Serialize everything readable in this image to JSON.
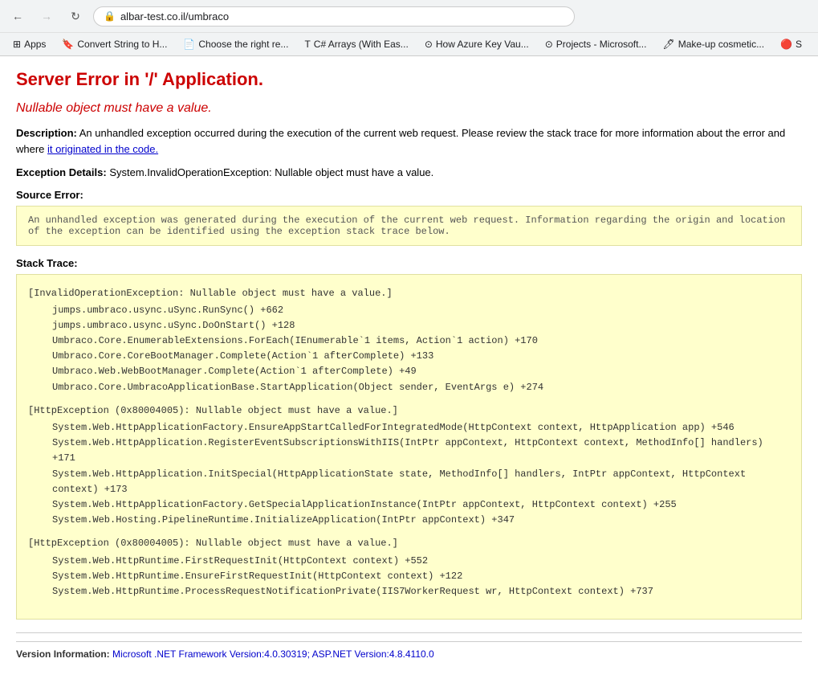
{
  "browser": {
    "url": "albar-test.co.il/umbraco",
    "back_disabled": false,
    "forward_disabled": true,
    "bookmarks": [
      {
        "id": "apps",
        "label": "Apps",
        "icon": "⊞"
      },
      {
        "id": "convert-string",
        "label": "Convert String to H...",
        "icon": "🔖"
      },
      {
        "id": "choose-right",
        "label": "Choose the right re...",
        "icon": "📄"
      },
      {
        "id": "csharp-arrays",
        "label": "C# Arrays (With Eas...",
        "icon": "T"
      },
      {
        "id": "azure-key",
        "label": "How Azure Key Vau...",
        "icon": "⊙"
      },
      {
        "id": "projects-ms",
        "label": "Projects - Microsoft...",
        "icon": "⊙"
      },
      {
        "id": "makeup",
        "label": "Make-up cosmetic...",
        "icon": "🖊"
      },
      {
        "id": "more",
        "label": "S",
        "icon": "🔴"
      }
    ]
  },
  "page": {
    "title": "Server Error in '/' Application.",
    "subtitle": "Nullable object must have a value.",
    "description_label": "Description:",
    "description_text": "An unhandled exception occurred during the execution of the current web request. Please review the stack trace for more information about the error and where",
    "description_link": "it originated in the code.",
    "exception_label": "Exception Details:",
    "exception_text": "System.InvalidOperationException: Nullable object must have a value.",
    "source_error_label": "Source Error:",
    "source_error_text": "An unhandled exception was generated during the execution of the current web request. Information regarding the origin and location of the exception can be identified using the exception stack trace below.",
    "stack_trace_label": "Stack Trace:",
    "stack_trace": [
      {
        "header": "[InvalidOperationException: Nullable object must have a value.]",
        "lines": [
          "jumps.umbraco.usync.uSync.RunSync() +662",
          "jumps.umbraco.usync.uSync.DoOnStart() +128",
          "Umbraco.Core.EnumerableExtensions.ForEach(IEnumerable`1 items, Action`1 action) +170",
          "Umbraco.Core.CoreBootManager.Complete(Action`1 afterComplete) +133",
          "Umbraco.Web.WebBootManager.Complete(Action`1 afterComplete) +49",
          "Umbraco.Core.UmbracoApplicationBase.StartApplication(Object sender, EventArgs e) +274"
        ]
      },
      {
        "header": "[HttpException (0x80004005): Nullable object must have a value.]",
        "lines": [
          "System.Web.HttpApplicationFactory.EnsureAppStartCalledForIntegratedMode(HttpContext context, HttpApplication app) +546",
          "System.Web.HttpApplication.RegisterEventSubscriptionsWithIIS(IntPtr appContext, HttpContext context, MethodInfo[] handlers) +171",
          "System.Web.HttpApplication.InitSpecial(HttpApplicationState state, MethodInfo[] handlers, IntPtr appContext, HttpContext context) +173",
          "System.Web.HttpApplicationFactory.GetSpecialApplicationInstance(IntPtr appContext, HttpContext context) +255",
          "System.Web.Hosting.PipelineRuntime.InitializeApplication(IntPtr appContext) +347"
        ]
      },
      {
        "header": "[HttpException (0x80004005): Nullable object must have a value.]",
        "lines": [
          "System.Web.HttpRuntime.FirstRequestInit(HttpContext context) +552",
          "System.Web.HttpRuntime.EnsureFirstRequestInit(HttpContext context) +122",
          "System.Web.HttpRuntime.ProcessRequestNotificationPrivate(IIS7WorkerRequest wr, HttpContext context) +737"
        ]
      }
    ],
    "version_label": "Version Information:",
    "version_text": "Microsoft .NET Framework Version:4.0.30319; ASP.NET Version:4.8.4110.0"
  }
}
